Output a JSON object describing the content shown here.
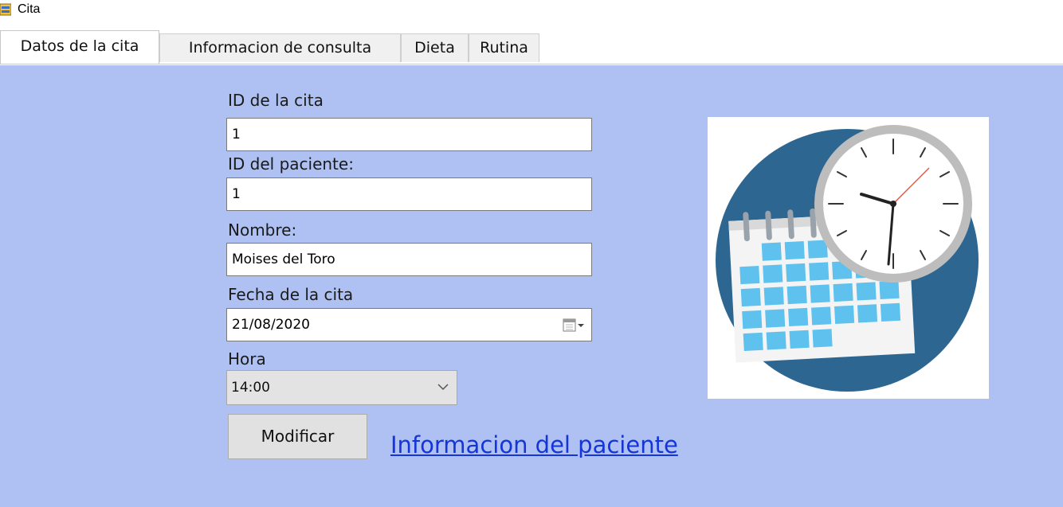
{
  "window": {
    "title": "Cita",
    "icon": "app-form-icon"
  },
  "tabs": [
    {
      "label": "Datos de la cita",
      "active": true
    },
    {
      "label": "Informacion de consulta",
      "active": false
    },
    {
      "label": "Dieta",
      "active": false
    },
    {
      "label": "Rutina",
      "active": false
    }
  ],
  "form": {
    "id_cita_label": "ID de la cita",
    "id_cita_value": "1",
    "id_paciente_label": "ID del paciente:",
    "id_paciente_value": "1",
    "nombre_label": "Nombre:",
    "nombre_value": "Moises del Toro",
    "fecha_label": "Fecha de la cita",
    "fecha_value": "21/08/2020",
    "hora_label": "Hora",
    "hora_value": "14:00",
    "modificar_label": "Modificar",
    "link_label": "Informacion del paciente"
  },
  "colors": {
    "panel_background": "#aec1f2",
    "link": "#1535d8",
    "calendar_circle": "#2d6691",
    "calendar_cells": "#5ec1ee"
  },
  "picture": {
    "icon": "calendar-clock-icon"
  }
}
